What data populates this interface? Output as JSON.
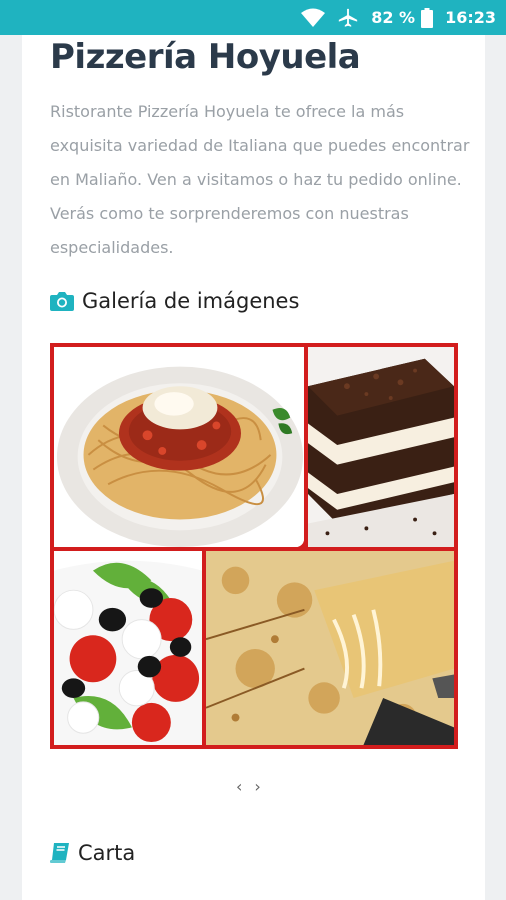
{
  "status_bar": {
    "battery": "82 %",
    "time": "16:23",
    "icons": [
      "wifi-icon",
      "airplane-mode-icon",
      "battery-icon"
    ]
  },
  "restaurant": {
    "name": "Pizzería Hoyuela",
    "description": "Ristorante Pizzería Hoyuela te ofrece la más exquisita variedad de Italiana que puedes encontrar en Maliaño. Ven a visitamos o haz tu pedido online. Verás como te sorprenderemos con nuestras especialidades."
  },
  "gallery": {
    "heading": "Galería de imágenes",
    "icon": "camera-icon",
    "images": [
      "spaghetti-bolognese-photo",
      "tiramisu-photo",
      "caprese-salad-photo",
      "cheese-pizza-photo"
    ],
    "prev": "‹",
    "next": "›"
  },
  "menu_section": {
    "heading": "Carta",
    "icon": "book-icon"
  },
  "colors": {
    "accent": "#1fb3c0",
    "title": "#2b3a4a",
    "gallery_border": "#d21d1d"
  }
}
